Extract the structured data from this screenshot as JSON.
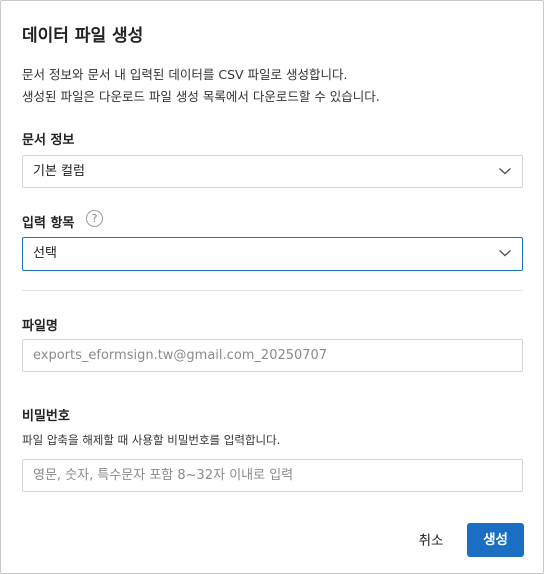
{
  "dialog": {
    "title": "데이터 파일 생성",
    "description_line1": "문서 정보와 문서 내 입력된 데이터를 CSV 파일로 생성합니다.",
    "description_line2": "생성된 파일은 다운로드 파일 생성 목록에서 다운로드할 수 있습니다."
  },
  "document_info": {
    "label": "문서 정보",
    "selected_value": "기본 컬럼"
  },
  "input_items": {
    "label": "입력 항목",
    "help_icon": "question-circle-icon",
    "selected_value": "선택"
  },
  "file_name": {
    "label": "파일명",
    "value": "exports_eformsign.tw@gmail.com_20250707"
  },
  "password": {
    "label": "비밀번호",
    "hint": "파일 압축을 해제할 때 사용할 비밀번호를 입력합니다.",
    "placeholder": "영문, 숫자, 특수문자 포함 8~32자 이내로 입력"
  },
  "footer": {
    "cancel_label": "취소",
    "create_label": "생성"
  },
  "colors": {
    "accent": "#1a6fc2",
    "focus_border": "#1a73c7"
  }
}
